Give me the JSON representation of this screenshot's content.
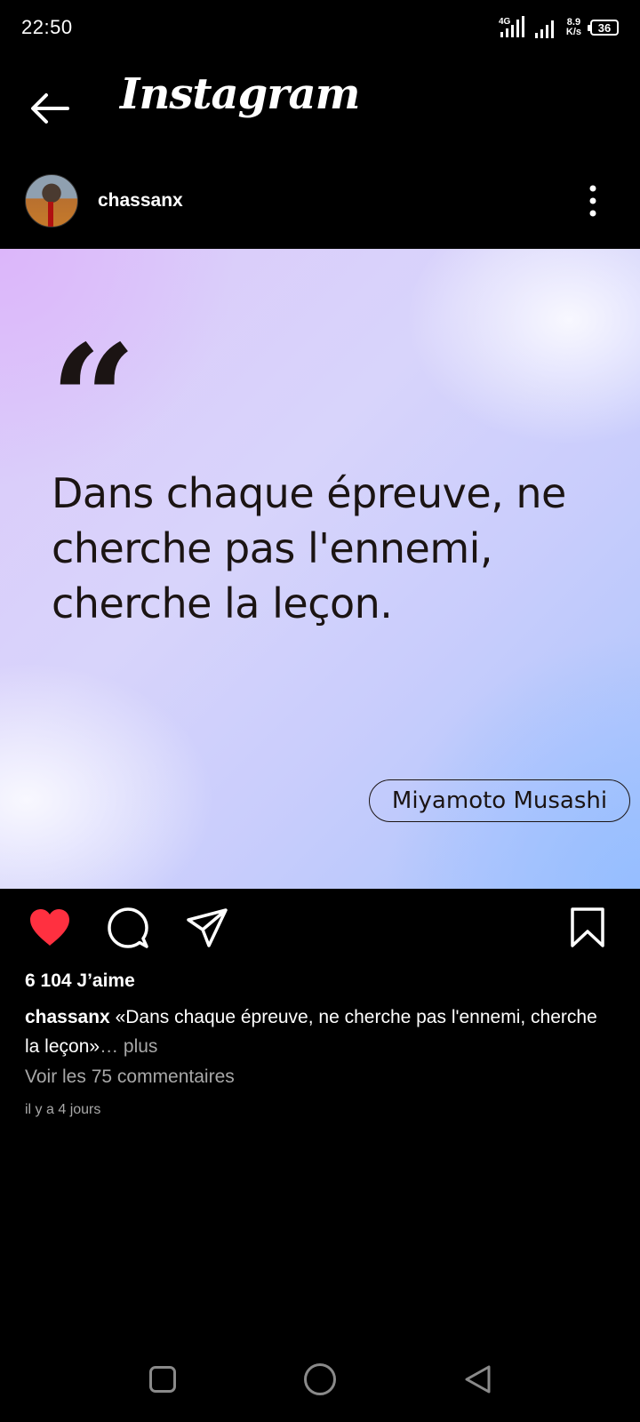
{
  "status_bar": {
    "time": "22:50",
    "network": "4G",
    "net_speed_value": "8.9",
    "net_speed_unit": "K/s",
    "battery": "36"
  },
  "header": {
    "back_icon": "arrow-left-icon",
    "title": "Instagram"
  },
  "post": {
    "username": "chassanx",
    "more_icon": "more-vertical-icon",
    "image": {
      "quote_mark": "“",
      "quote_text": "Dans chaque épreuve, ne cherche pas l'ennemi, cherche la leçon.",
      "author": "Miyamoto Musashi"
    },
    "actions": {
      "like_icon": "heart-filled-icon",
      "like_color": "#ff3040",
      "comment_icon": "comment-icon",
      "share_icon": "send-icon",
      "save_icon": "bookmark-icon"
    },
    "likes": "6 104 J’aime",
    "caption_user": "chassanx",
    "caption_text": " «Dans chaque épreuve, ne cherche pas l'ennemi, cherche la leçon»",
    "caption_more": "… plus",
    "view_comments": "Voir les 75 commentaires",
    "timestamp": "il y a 4 jours"
  },
  "nav_bar": {
    "recents_icon": "square-icon",
    "home_icon": "circle-icon",
    "back_icon": "triangle-back-icon"
  }
}
